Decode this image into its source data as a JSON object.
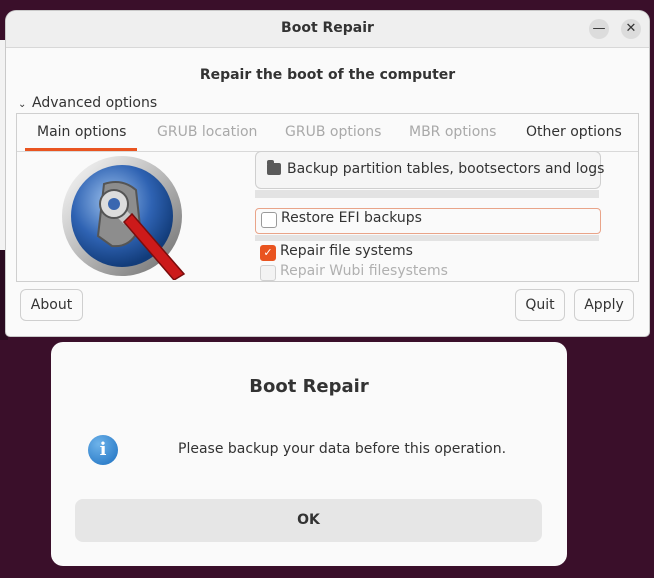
{
  "window": {
    "title": "Boot Repair",
    "minimize_glyph": "—",
    "close_glyph": "✕"
  },
  "main": {
    "heading": "Repair the boot of the computer",
    "advanced_label": "Advanced options",
    "advanced_chevron": "⌄",
    "tabs": [
      {
        "label": "Main options",
        "active": true
      },
      {
        "label": "GRUB location",
        "active": false
      },
      {
        "label": "GRUB options",
        "active": false
      },
      {
        "label": "MBR options",
        "active": false
      },
      {
        "label": "Other options",
        "active": false
      }
    ],
    "backup_button": "Backup partition tables, bootsectors and logs",
    "options": [
      {
        "label": "Restore EFI backups",
        "checked": false,
        "enabled": true
      },
      {
        "label": "Repair file systems",
        "checked": true,
        "enabled": true
      },
      {
        "label": "Repair Wubi filesystems",
        "checked": false,
        "enabled": false
      }
    ],
    "buttons": {
      "about": "About",
      "quit": "Quit",
      "apply": "Apply"
    },
    "accent_color": "#e95420"
  },
  "dialog": {
    "title": "Boot Repair",
    "message": "Please backup your data before this operation.",
    "icon": "info-icon",
    "ok_label": "OK"
  }
}
